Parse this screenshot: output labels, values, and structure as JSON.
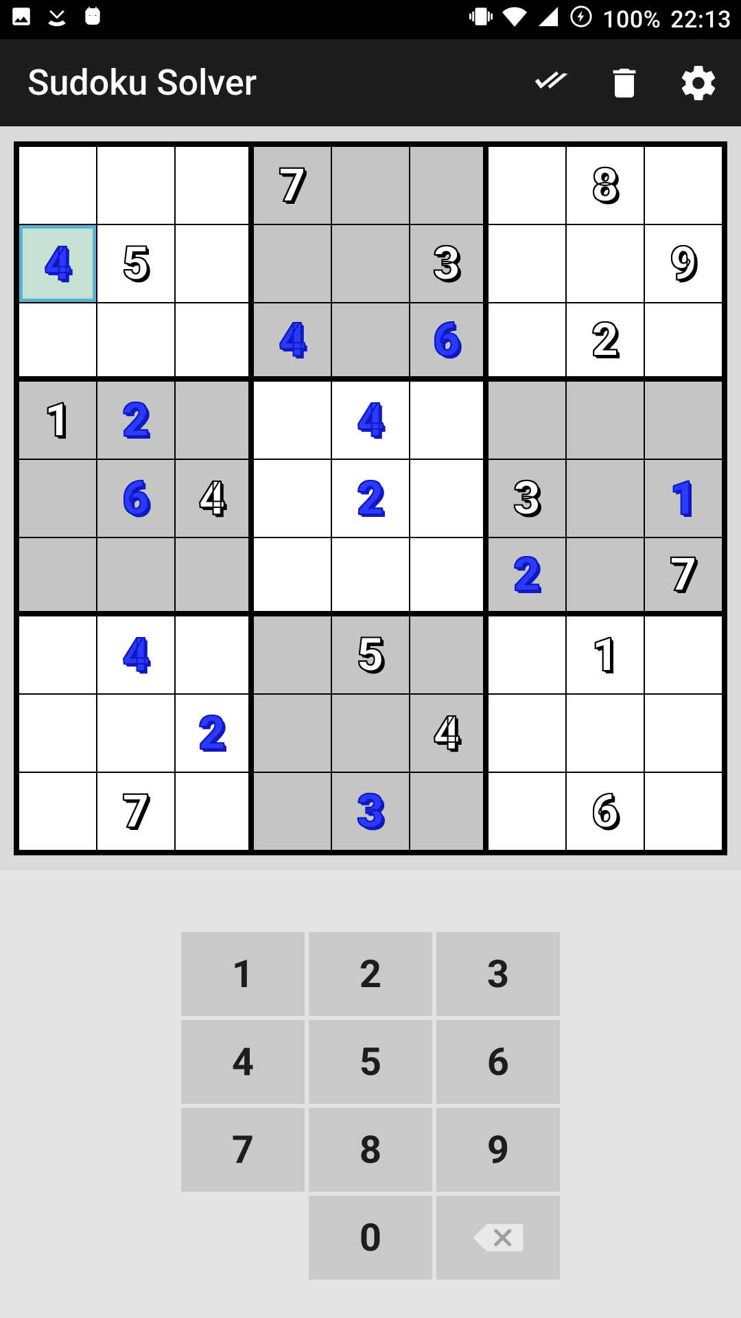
{
  "status": {
    "battery": "100%",
    "time": "22:13"
  },
  "appbar": {
    "title": "Sudoku Solver"
  },
  "board": {
    "selected": [
      1,
      0
    ],
    "cells": [
      [
        null,
        null,
        null,
        {
          "v": "7",
          "c": "black"
        },
        null,
        null,
        null,
        {
          "v": "8",
          "c": "black"
        },
        null
      ],
      [
        {
          "v": "4",
          "c": "blue"
        },
        {
          "v": "5",
          "c": "black"
        },
        null,
        null,
        null,
        {
          "v": "3",
          "c": "black"
        },
        null,
        null,
        {
          "v": "9",
          "c": "black"
        }
      ],
      [
        null,
        null,
        null,
        {
          "v": "4",
          "c": "blue"
        },
        null,
        {
          "v": "6",
          "c": "blue"
        },
        null,
        {
          "v": "2",
          "c": "black"
        },
        null
      ],
      [
        {
          "v": "1",
          "c": "black"
        },
        {
          "v": "2",
          "c": "blue"
        },
        null,
        null,
        {
          "v": "4",
          "c": "blue"
        },
        null,
        null,
        null,
        null
      ],
      [
        null,
        {
          "v": "6",
          "c": "blue"
        },
        {
          "v": "4",
          "c": "black"
        },
        null,
        {
          "v": "2",
          "c": "blue"
        },
        null,
        {
          "v": "3",
          "c": "black"
        },
        null,
        {
          "v": "1",
          "c": "blue"
        }
      ],
      [
        null,
        null,
        null,
        null,
        null,
        null,
        {
          "v": "2",
          "c": "blue"
        },
        null,
        {
          "v": "7",
          "c": "black"
        }
      ],
      [
        null,
        {
          "v": "4",
          "c": "blue"
        },
        null,
        null,
        {
          "v": "5",
          "c": "black"
        },
        null,
        null,
        {
          "v": "1",
          "c": "black"
        },
        null
      ],
      [
        null,
        null,
        {
          "v": "2",
          "c": "blue"
        },
        null,
        null,
        {
          "v": "4",
          "c": "black"
        },
        null,
        null,
        null
      ],
      [
        null,
        {
          "v": "7",
          "c": "black"
        },
        null,
        null,
        {
          "v": "3",
          "c": "blue"
        },
        null,
        null,
        {
          "v": "6",
          "c": "black"
        },
        null
      ]
    ]
  },
  "keypad": {
    "keys": [
      "1",
      "2",
      "3",
      "4",
      "5",
      "6",
      "7",
      "8",
      "9"
    ],
    "zero": "0"
  }
}
